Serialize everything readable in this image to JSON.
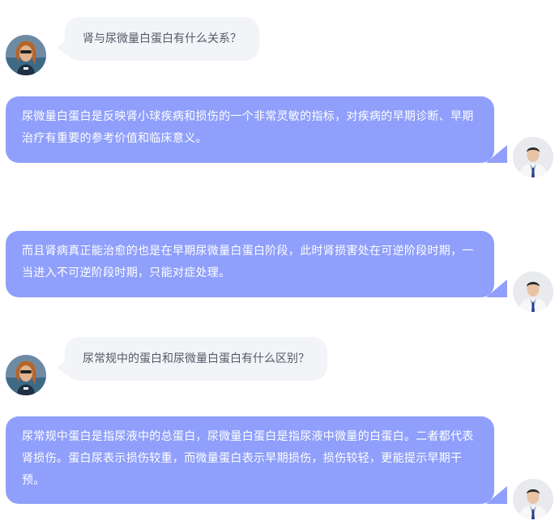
{
  "chat": {
    "messages": [
      {
        "role": "user",
        "text": "肾与尿微量白蛋白有什么关系？"
      },
      {
        "role": "doctor",
        "text": "尿微量白蛋白是反映肾小球疾病和损伤的一个非常灵敏的指标，对疾病的早期诊断、早期治疗有重要的参考价值和临床意义。"
      },
      {
        "role": "doctor",
        "text": "而且肾病真正能治愈的也是在早期尿微量白蛋白阶段，此时肾损害处在可逆阶段时期，一当进入不可逆阶段时期，只能对症处理。"
      },
      {
        "role": "user",
        "text": "尿常规中的蛋白和尿微量白蛋白有什么区别？"
      },
      {
        "role": "doctor",
        "text": "尿常规中蛋白是指尿液中的总蛋白，尿微量白蛋白是指尿液中微量的白蛋白。二者都代表肾损伤。蛋白尿表示损伤较重，而微量蛋白表示早期损伤，损伤较轻，更能提示早期干预。"
      }
    ]
  },
  "colors": {
    "doctor_bubble": "#8f9ffb",
    "user_bubble": "#f3f4f8",
    "user_text": "#555a66",
    "doctor_text": "#ffffff"
  }
}
